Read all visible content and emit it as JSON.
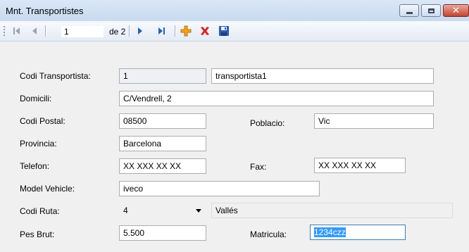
{
  "window": {
    "title": "Mnt. Transportistes",
    "buttons": {
      "minimize": "minimize",
      "maximize": "maximize",
      "close": "close"
    }
  },
  "toolbar": {
    "position_value": "1",
    "count_label": "de 2",
    "icons": [
      "move-first-icon",
      "move-previous-icon",
      "move-next-icon",
      "move-last-icon",
      "add-icon",
      "delete-icon",
      "save-icon"
    ]
  },
  "form": {
    "codi_transportista": {
      "label": "Codi Transportista:",
      "value": "1",
      "name_value": "transportista1"
    },
    "domicili": {
      "label": "Domicili:",
      "value": "C/Vendrell, 2"
    },
    "codi_postal": {
      "label": "Codi Postal:",
      "value": "08500"
    },
    "poblacio": {
      "label": "Poblacio:",
      "value": "Vic"
    },
    "provincia": {
      "label": "Provincia:",
      "value": "Barcelona"
    },
    "telefon": {
      "label": "Telefon:",
      "value": "XX XXX XX XX"
    },
    "fax": {
      "label": "Fax:",
      "value": "XX XXX XX XX"
    },
    "model_vehicle": {
      "label": "Model Vehicle:",
      "value": "iveco"
    },
    "codi_ruta": {
      "label": "Codi Ruta:",
      "value": "4",
      "route_name": "Vallés"
    },
    "pes_brut": {
      "label": "Pes Brut:",
      "value": "5.500"
    },
    "matricula": {
      "label": "Matricula:",
      "value": "1234czz"
    }
  },
  "colors": {
    "titlebar": "#c8d9f0",
    "window_bg": "#f0f0f0",
    "accent_blue": "#1f63b8",
    "delete_red": "#e0201e",
    "add_orange": "#f2a519",
    "selection": "#3399ff"
  }
}
